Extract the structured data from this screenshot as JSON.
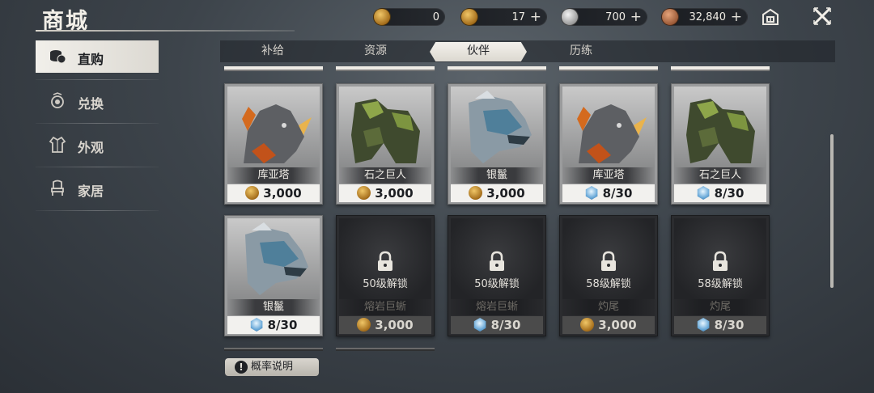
{
  "header": {
    "title": "商城"
  },
  "currencies": [
    {
      "icon": "gold-coin-icon",
      "value": "0",
      "has_plus": false
    },
    {
      "icon": "gold-ingot-icon",
      "value": "17",
      "has_plus": true
    },
    {
      "icon": "silver-coin-icon",
      "value": "700",
      "has_plus": true
    },
    {
      "icon": "copper-coin-icon",
      "value": "32,840",
      "has_plus": true
    }
  ],
  "plus_label": "+",
  "sidebar": {
    "items": [
      {
        "label": "直购",
        "icon": "coin-stack-icon",
        "active": true
      },
      {
        "label": "兑换",
        "icon": "exchange-emblem-icon",
        "active": false
      },
      {
        "label": "外观",
        "icon": "robe-icon",
        "active": false
      },
      {
        "label": "家居",
        "icon": "throne-icon",
        "active": false
      }
    ]
  },
  "tabs": [
    {
      "label": "补给",
      "active": false
    },
    {
      "label": "资源",
      "active": false
    },
    {
      "label": "伙伴",
      "active": true
    },
    {
      "label": "历练",
      "active": false
    }
  ],
  "cards": [
    {
      "name": "库亚塔",
      "price": "3,000",
      "currency": "gold-coin",
      "locked": false,
      "creature": "fire-rhino"
    },
    {
      "name": "石之巨人",
      "price": "3,000",
      "currency": "gold-coin",
      "locked": false,
      "creature": "stone-giant"
    },
    {
      "name": "银鬣",
      "price": "3,000",
      "currency": "gold-coin",
      "locked": false,
      "creature": "silver-wolf"
    },
    {
      "name": "库亚塔",
      "price": "8/30",
      "currency": "blue-gem",
      "locked": false,
      "creature": "fire-rhino"
    },
    {
      "name": "石之巨人",
      "price": "8/30",
      "currency": "blue-gem",
      "locked": false,
      "creature": "stone-giant"
    },
    {
      "name": "银鬣",
      "price": "8/30",
      "currency": "blue-gem",
      "locked": false,
      "creature": "silver-wolf"
    },
    {
      "name": "熔岩巨蜥",
      "price": "3,000",
      "currency": "gold-coin",
      "locked": true,
      "lock_text": "50级解锁"
    },
    {
      "name": "熔岩巨蜥",
      "price": "8/30",
      "currency": "blue-gem",
      "locked": true,
      "lock_text": "50级解锁"
    },
    {
      "name": "灼尾",
      "price": "3,000",
      "currency": "gold-coin",
      "locked": true,
      "lock_text": "58级解锁"
    },
    {
      "name": "灼尾",
      "price": "8/30",
      "currency": "blue-gem",
      "locked": true,
      "lock_text": "58级解锁"
    }
  ],
  "footer": {
    "probability_label": "概率说明"
  },
  "colors": {
    "accent_light": "#f2f1ee",
    "panel_dark": "#2b2c2f",
    "gold": "#c58a2a",
    "gem_blue": "#6aa9d8"
  }
}
